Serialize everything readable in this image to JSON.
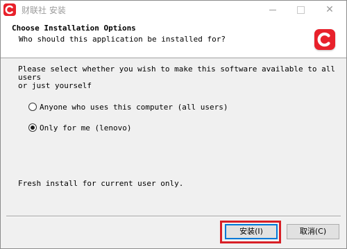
{
  "window": {
    "title": "财联社 安装",
    "minimize_icon": "minimize-icon",
    "maximize_icon": "maximize-icon",
    "close_symbol": "✕"
  },
  "header": {
    "title": "Choose Installation Options",
    "subtitle": "Who should this application be installed for?",
    "logo_letter": "C",
    "brand_color": "#e8212b"
  },
  "content": {
    "description": "Please select whether you wish to make this software available to all users\nor just yourself",
    "options": [
      {
        "label": "Anyone who uses this computer (all users)",
        "checked": false
      },
      {
        "label": "Only for me (lenovo)",
        "checked": true
      }
    ],
    "status": "Fresh install for current user only."
  },
  "buttons": {
    "install": "安装(I)",
    "cancel": "取消(C)"
  },
  "accent": "#0078d7",
  "highlight_color": "#d81f26"
}
